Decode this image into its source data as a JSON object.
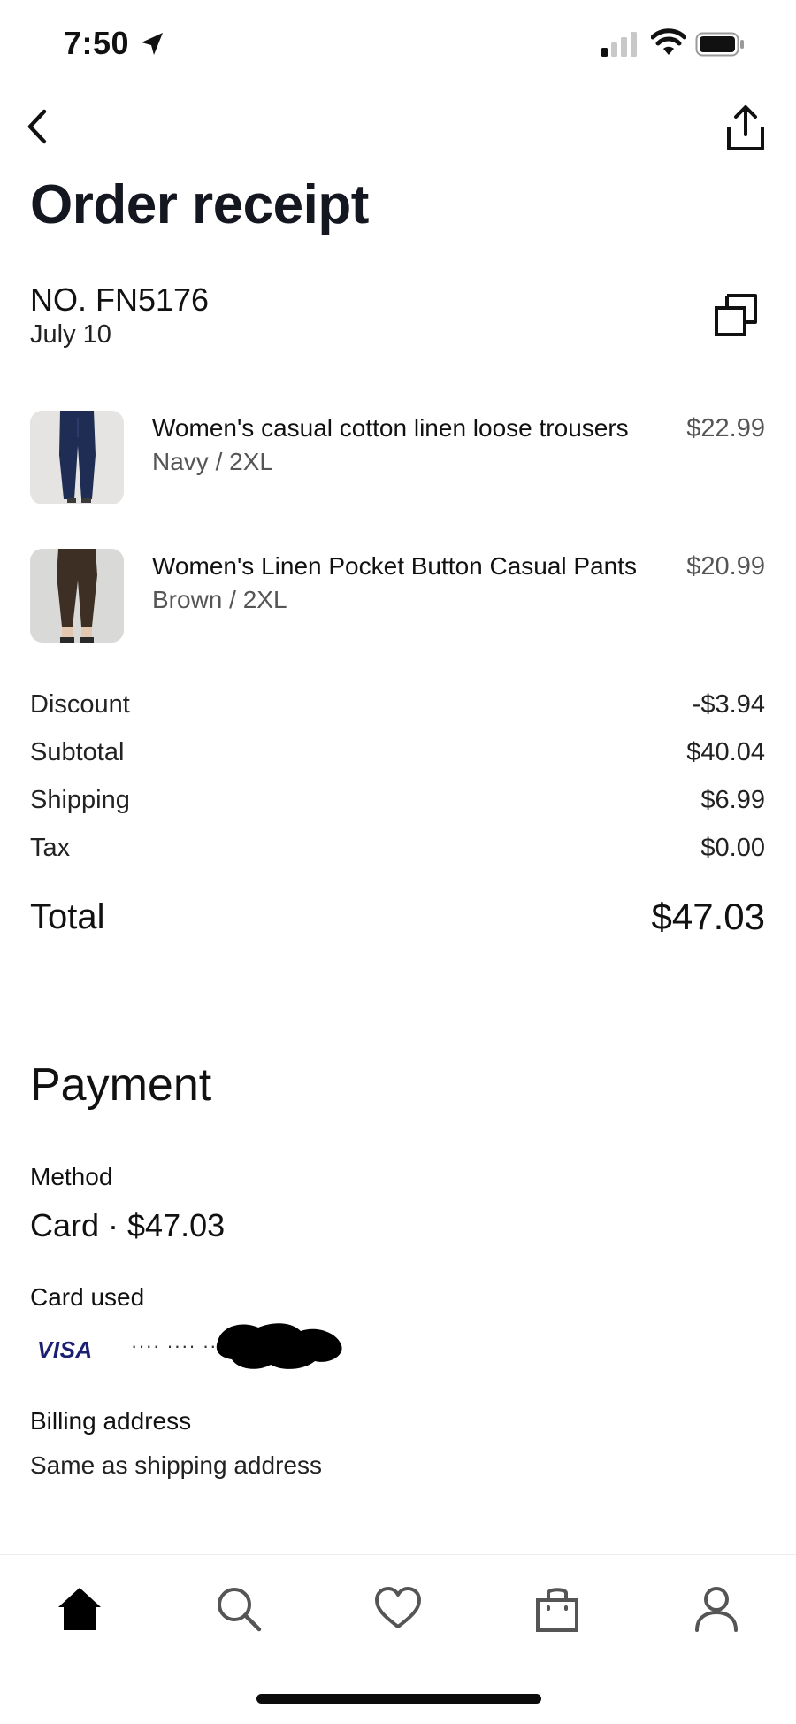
{
  "status_bar": {
    "time": "7:50"
  },
  "header": {
    "title": "Order receipt"
  },
  "order": {
    "number": "NO. FN5176",
    "date": "July 10"
  },
  "items": [
    {
      "title": "Women's casual cotton linen loose trousers",
      "variant": "Navy / 2XL",
      "price": "$22.99"
    },
    {
      "title": "Women's Linen Pocket Button Casual Pants",
      "variant": "Brown / 2XL",
      "price": "$20.99"
    }
  ],
  "summary": {
    "discount_label": "Discount",
    "discount": "-$3.94",
    "subtotal_label": "Subtotal",
    "subtotal": "$40.04",
    "shipping_label": "Shipping",
    "shipping": "$6.99",
    "tax_label": "Tax",
    "tax": "$0.00",
    "total_label": "Total",
    "total": "$47.03"
  },
  "payment": {
    "heading": "Payment",
    "method_label": "Method",
    "method_value": "Card · $47.03",
    "card_label": "Card used",
    "card_brand": "VISA",
    "card_masked": "···· ···· ····",
    "billing_label": "Billing address",
    "billing_value": "Same as shipping address"
  },
  "tabbar": {
    "icons": [
      "home-icon",
      "search-icon",
      "heart-icon",
      "bag-icon",
      "profile-icon"
    ],
    "active": "home-icon"
  },
  "colors": {
    "text": "#111111",
    "muted": "#555555",
    "visa": "#1a1f71",
    "title": "#14171f"
  }
}
